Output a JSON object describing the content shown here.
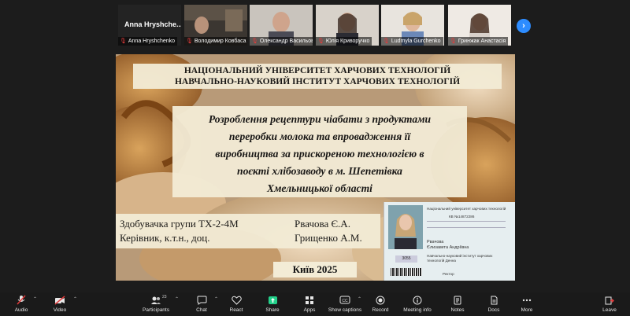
{
  "participants": {
    "first_tile_name": "Anna  Hryshche...",
    "tiles": [
      {
        "label": "Anna Hryshchenko",
        "mic_muted": true
      },
      {
        "label": "Володимир Ковбаса",
        "mic_muted": true
      },
      {
        "label": "Олександр Васильович Г...",
        "mic_muted": true
      },
      {
        "label": "Юлія Криворучко",
        "mic_muted": true
      },
      {
        "label": "Ludmyla Gurchenko",
        "mic_muted": true
      },
      {
        "label": "Гринжак Анастасія",
        "mic_muted": true
      }
    ],
    "active_speaker_index": 4,
    "next_icon": "chevron-right-icon",
    "colors": {
      "active_border": "#23d18b",
      "muted_mic": "#e23b3b",
      "next_button": "#2d8cff"
    }
  },
  "slide": {
    "university_line1": "НАЦІОНАЛЬНИЙ УНІВЕРСИТЕТ ХАРЧОВИХ ТЕХНОЛОГІЙ",
    "university_line2": "НАВЧАЛЬНО-НАУКОВИЙ ІНСТИТУТ ХАРЧОВИХ ТЕХНОЛОГІЙ",
    "topic_lines": [
      "Розроблення рецептури чіабати з продуктами",
      "переробки молока та впровадження її",
      "виробництва за прискореною технологією в",
      "поєкті хлібозаводу в м. Шепетівка",
      "Хмельницької області"
    ],
    "applicant_label": "Здобувачка групи ТХ-2-4М",
    "applicant_name": "Рвачова Є.А.",
    "supervisor_label": "Керівник, к.т.н., доц.",
    "supervisor_name": "Грищенко А.М.",
    "city_year": "Київ 2025",
    "id_card": {
      "header": "Національний університет харчових технологій",
      "number": "КВ №14872286",
      "surname": "Рвачова",
      "given_names": "Єлизавета Андріївна",
      "institute_line1": "Навчально-науковий інститут харчових",
      "institute_line2": "технологій   Денна",
      "photo_number": "3055",
      "signer": "Ректор"
    }
  },
  "toolbar": {
    "audio": "Audio",
    "video": "Video",
    "participants": "Participants",
    "participants_count": "23",
    "chat": "Chat",
    "react": "React",
    "share": "Share",
    "apps": "Apps",
    "captions": "Show captions",
    "record": "Record",
    "meeting_info": "Meeting info",
    "notes": "Notes",
    "docs": "Docs",
    "more": "More",
    "leave": "Leave",
    "colors": {
      "muted": "#e23b3b",
      "share": "#23d18b",
      "leave": "#e23b3b"
    }
  }
}
